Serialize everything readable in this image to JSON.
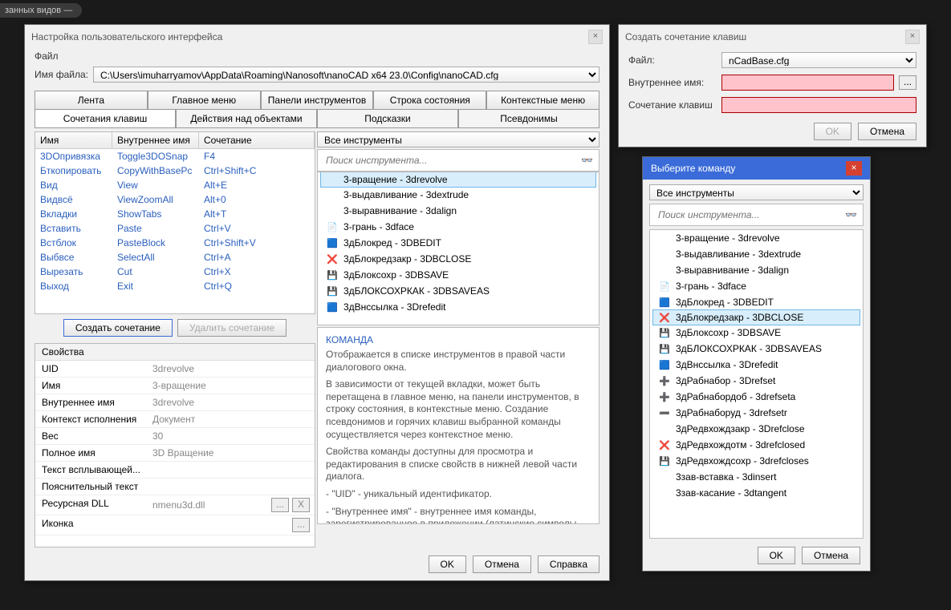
{
  "crumb": "занных видов —",
  "dlg1": {
    "title": "Настройка пользовательского интерфейса",
    "menu_file": "Файл",
    "file_label": "Имя файла:",
    "file_path": "C:\\Users\\imuharryamov\\AppData\\Roaming\\Nanosoft\\nanoCAD x64 23.0\\Config\\nanoCAD.cfg",
    "tabs_main": [
      "Лента",
      "Главное меню",
      "Панели инструментов",
      "Строка состояния",
      "Контекстные меню"
    ],
    "tabs_sub": [
      "Сочетания клавиш",
      "Действия над объектами",
      "Подсказки",
      "Псевдонимы"
    ],
    "tabs_sub_active": 0,
    "th": {
      "name": "Имя",
      "int": "Внутреннее имя",
      "kb": "Сочетание"
    },
    "shortcuts": [
      {
        "n": "3DОпривязка",
        "i": "Toggle3DOSnap",
        "k": "F4"
      },
      {
        "n": "Бткопировать",
        "i": "CopyWithBasePc",
        "k": "Ctrl+Shift+C"
      },
      {
        "n": "Вид",
        "i": "View",
        "k": "Alt+E"
      },
      {
        "n": "Видвсё",
        "i": "ViewZoomAll",
        "k": "Alt+0"
      },
      {
        "n": "Вкладки",
        "i": "ShowTabs",
        "k": "Alt+T"
      },
      {
        "n": "Вставить",
        "i": "Paste",
        "k": "Ctrl+V"
      },
      {
        "n": "Встблок",
        "i": "PasteBlock",
        "k": "Ctrl+Shift+V"
      },
      {
        "n": "Выбвсе",
        "i": "SelectAll",
        "k": "Ctrl+A"
      },
      {
        "n": "Вырезать",
        "i": "Cut",
        "k": "Ctrl+X"
      },
      {
        "n": "Выход",
        "i": "Exit",
        "k": "Ctrl+Q"
      }
    ],
    "btn_create": "Создать сочетание",
    "btn_delete": "Удалить сочетание",
    "props_head": "Свойства",
    "props": [
      {
        "k": "UID",
        "v": "3drevolve"
      },
      {
        "k": "Имя",
        "v": "3-вращение"
      },
      {
        "k": "Внутреннее имя",
        "v": "3drevolve"
      },
      {
        "k": "Контекст исполнения",
        "v": "Документ"
      },
      {
        "k": "Вес",
        "v": "30"
      },
      {
        "k": "Полное имя",
        "v": "3D Вращение"
      },
      {
        "k": "Текст всплывающей...",
        "v": ""
      },
      {
        "k": "Пояснительный текст",
        "v": ""
      },
      {
        "k": "Ресурсная DLL",
        "v": "nmenu3d.dll",
        "btn": "both"
      },
      {
        "k": "Иконка",
        "v": "",
        "btn": "dots"
      }
    ],
    "tool_sel": "Все инструменты",
    "tool_ph": "Поиск инструмента...",
    "tools": [
      {
        "n": "3-вращение - 3drevolve",
        "sel": true
      },
      {
        "n": "3-выдавливание - 3dextrude"
      },
      {
        "n": "3-выравнивание - 3dalign"
      },
      {
        "n": "3-грань - 3dface",
        "ico": "📄"
      },
      {
        "n": "3дБлокред - 3DBEDIT",
        "ico": "🟦"
      },
      {
        "n": "3дБлокредзакр - 3DBCLOSE",
        "ico": "❌"
      },
      {
        "n": "3дБлоксохр - 3DBSAVE",
        "ico": "💾"
      },
      {
        "n": "3дБЛОКСОХРКАК - 3DBSAVEAS",
        "ico": "💾"
      },
      {
        "n": "3дВнссылка - 3Drefedit",
        "ico": "🟦"
      }
    ],
    "desc_h": "КОМАНДА",
    "desc_p1": "Отображается в списке инструментов в правой части диалогового окна.",
    "desc_p2": "В зависимости от текущей вкладки, может быть перетащена в главное меню, на панели инструментов, в строку состояния, в контекстные меню. Создание псевдонимов и горячих клавиш выбранной команды осуществляется через контекстное меню.",
    "desc_p3": "Свойства команды доступны для просмотра и редактирования в списке свойств в нижней левой части диалога.",
    "desc_p4": "  - \"UID\" - уникальный идентификатор.",
    "desc_p5": "  - \"Внутреннее имя\" - внутреннее имя команды, зарегистрированное в приложении (латинские символы без пробелов). Часто совпадает с UID. Может",
    "btn_ok": "OK",
    "btn_cancel": "Отмена",
    "btn_help": "Справка"
  },
  "dlg2": {
    "title": "Создать сочетание клавиш",
    "file_l": "Файл:",
    "file_v": "nCadBase.cfg",
    "name_l": "Внутреннее имя:",
    "kb_l": "Сочетание клавиш",
    "btn_ok": "OK",
    "btn_cancel": "Отмена",
    "btn_dots": "..."
  },
  "dlg3": {
    "title": "Выберите команду",
    "sel": "Все инструменты",
    "ph": "Поиск инструмента...",
    "items": [
      {
        "n": "3-вращение - 3drevolve"
      },
      {
        "n": "3-выдавливание - 3dextrude"
      },
      {
        "n": "3-выравнивание - 3dalign"
      },
      {
        "n": "3-грань - 3dface",
        "ico": "📄"
      },
      {
        "n": "3дБлокред - 3DBEDIT",
        "ico": "🟦"
      },
      {
        "n": "3дБлокредзакр - 3DBCLOSE",
        "ico": "❌",
        "sel": true
      },
      {
        "n": "3дБлоксохр - 3DBSAVE",
        "ico": "💾"
      },
      {
        "n": "3дБЛОКСОХРКАК - 3DBSAVEAS",
        "ico": "💾"
      },
      {
        "n": "3дВнссылка - 3Drefedit",
        "ico": "🟦"
      },
      {
        "n": "3дРабнабор - 3Drefset",
        "ico": "➕"
      },
      {
        "n": "3дРабнабордоб - 3drefseta",
        "ico": "➕"
      },
      {
        "n": "3дРабнаборуд - 3drefsetr",
        "ico": "➖"
      },
      {
        "n": "3дРедвхождзакр - 3Drefclose"
      },
      {
        "n": "3дРедвхождотм - 3drefclosed",
        "ico": "❌"
      },
      {
        "n": "3дРедвхождсохр - 3drefcloses",
        "ico": "💾"
      },
      {
        "n": "3зав-вставка - 3dinsert"
      },
      {
        "n": "3зав-касание - 3dtangent"
      }
    ],
    "btn_ok": "OK",
    "btn_cancel": "Отмена"
  }
}
